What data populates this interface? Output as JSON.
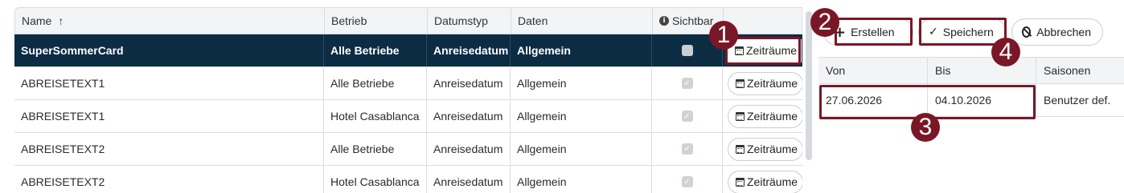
{
  "table": {
    "columns": {
      "name": "Name",
      "betrieb": "Betrieb",
      "datumstyp": "Datumstyp",
      "daten": "Daten",
      "sichtbar": "Sichtbar"
    },
    "sort_indicator": "↑",
    "action_label": "Zeiträume",
    "rows": [
      {
        "name": "SuperSommerCard",
        "betrieb": "Alle Betriebe",
        "datumstyp": "Anreisedatum",
        "daten": "Allgemein",
        "selected": true
      },
      {
        "name": "ABREISETEXT1",
        "betrieb": "Alle Betriebe",
        "datumstyp": "Anreisedatum",
        "daten": "Allgemein",
        "selected": false
      },
      {
        "name": "ABREISETEXT1",
        "betrieb": "Hotel Casablanca",
        "datumstyp": "Anreisedatum",
        "daten": "Allgemein",
        "selected": false
      },
      {
        "name": "ABREISETEXT2",
        "betrieb": "Alle Betriebe",
        "datumstyp": "Anreisedatum",
        "daten": "Allgemein",
        "selected": false
      },
      {
        "name": "ABREISETEXT2",
        "betrieb": "Hotel Casablanca",
        "datumstyp": "Anreisedatum",
        "daten": "Allgemein",
        "selected": false
      }
    ]
  },
  "toolbar": {
    "create_label": "Erstellen",
    "save_label": "Speichern",
    "cancel_label": "Abbrechen"
  },
  "periods": {
    "columns": {
      "von": "Von",
      "bis": "Bis",
      "saisonen": "Saisonen"
    },
    "row": {
      "von": "27.06.2026",
      "bis": "04.10.2026",
      "saisonen": "Benutzer def."
    }
  },
  "annotations": [
    "1",
    "2",
    "3",
    "4"
  ],
  "colors": {
    "selected_row": "#0c2c44",
    "annotation": "#7a1726"
  }
}
